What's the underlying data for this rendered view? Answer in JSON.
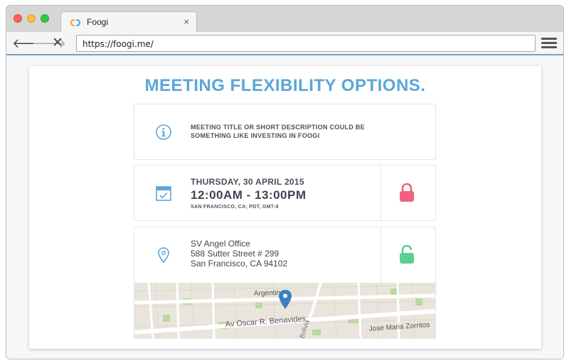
{
  "browser": {
    "tab_title": "Foogi",
    "tab_close": "×",
    "url": "https://foogi.me/"
  },
  "page": {
    "title": "MEETING FLEXIBILITY OPTIONS."
  },
  "info": {
    "text": "MEETING TITLE OR SHORT DESCRIPTION COULD BE SOMETHING LIKE INVESTING IN FOOGI"
  },
  "schedule": {
    "date": "THURSDAY, 30 APRIL 2015",
    "time_range": "12:00AM - 13:00PM",
    "timezone": "SAN FRANCISCO, CA; PDT, GMT-8",
    "locked": true
  },
  "location": {
    "name": "SV Angel Office",
    "street": "588 Sutter Street # 299",
    "city": "San Francisco, CA 94102",
    "locked": false
  },
  "map": {
    "streets": [
      "Argentine",
      "Av Oscar R. Benavides",
      "Jose Maria Zorritos",
      "Bolivia"
    ]
  },
  "colors": {
    "accent": "#5aa6d8",
    "lock_closed": "#f0627e",
    "lock_open": "#5ad08e",
    "map_pin": "#3a7fc0"
  }
}
